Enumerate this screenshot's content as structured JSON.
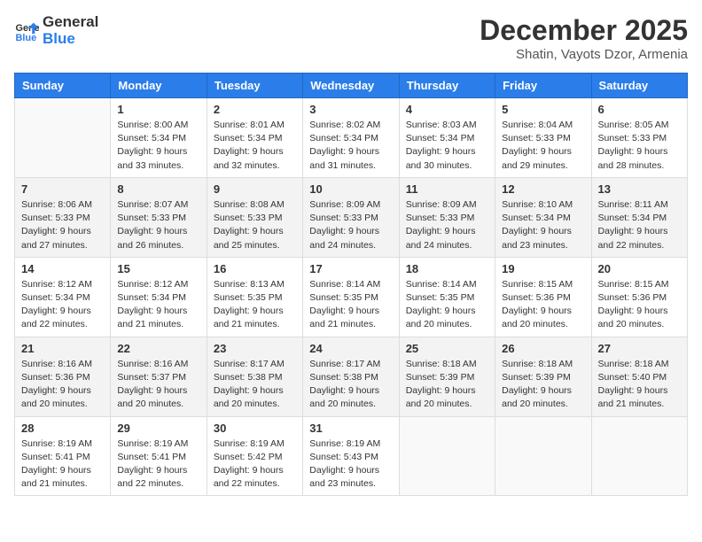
{
  "logo": {
    "general": "General",
    "blue": "Blue"
  },
  "title": "December 2025",
  "location": "Shatin, Vayots Dzor, Armenia",
  "days_of_week": [
    "Sunday",
    "Monday",
    "Tuesday",
    "Wednesday",
    "Thursday",
    "Friday",
    "Saturday"
  ],
  "weeks": [
    [
      {
        "day": "",
        "sunrise": "",
        "sunset": "",
        "daylight": ""
      },
      {
        "day": "1",
        "sunrise": "Sunrise: 8:00 AM",
        "sunset": "Sunset: 5:34 PM",
        "daylight": "Daylight: 9 hours and 33 minutes."
      },
      {
        "day": "2",
        "sunrise": "Sunrise: 8:01 AM",
        "sunset": "Sunset: 5:34 PM",
        "daylight": "Daylight: 9 hours and 32 minutes."
      },
      {
        "day": "3",
        "sunrise": "Sunrise: 8:02 AM",
        "sunset": "Sunset: 5:34 PM",
        "daylight": "Daylight: 9 hours and 31 minutes."
      },
      {
        "day": "4",
        "sunrise": "Sunrise: 8:03 AM",
        "sunset": "Sunset: 5:34 PM",
        "daylight": "Daylight: 9 hours and 30 minutes."
      },
      {
        "day": "5",
        "sunrise": "Sunrise: 8:04 AM",
        "sunset": "Sunset: 5:33 PM",
        "daylight": "Daylight: 9 hours and 29 minutes."
      },
      {
        "day": "6",
        "sunrise": "Sunrise: 8:05 AM",
        "sunset": "Sunset: 5:33 PM",
        "daylight": "Daylight: 9 hours and 28 minutes."
      }
    ],
    [
      {
        "day": "7",
        "sunrise": "Sunrise: 8:06 AM",
        "sunset": "Sunset: 5:33 PM",
        "daylight": "Daylight: 9 hours and 27 minutes."
      },
      {
        "day": "8",
        "sunrise": "Sunrise: 8:07 AM",
        "sunset": "Sunset: 5:33 PM",
        "daylight": "Daylight: 9 hours and 26 minutes."
      },
      {
        "day": "9",
        "sunrise": "Sunrise: 8:08 AM",
        "sunset": "Sunset: 5:33 PM",
        "daylight": "Daylight: 9 hours and 25 minutes."
      },
      {
        "day": "10",
        "sunrise": "Sunrise: 8:09 AM",
        "sunset": "Sunset: 5:33 PM",
        "daylight": "Daylight: 9 hours and 24 minutes."
      },
      {
        "day": "11",
        "sunrise": "Sunrise: 8:09 AM",
        "sunset": "Sunset: 5:33 PM",
        "daylight": "Daylight: 9 hours and 24 minutes."
      },
      {
        "day": "12",
        "sunrise": "Sunrise: 8:10 AM",
        "sunset": "Sunset: 5:34 PM",
        "daylight": "Daylight: 9 hours and 23 minutes."
      },
      {
        "day": "13",
        "sunrise": "Sunrise: 8:11 AM",
        "sunset": "Sunset: 5:34 PM",
        "daylight": "Daylight: 9 hours and 22 minutes."
      }
    ],
    [
      {
        "day": "14",
        "sunrise": "Sunrise: 8:12 AM",
        "sunset": "Sunset: 5:34 PM",
        "daylight": "Daylight: 9 hours and 22 minutes."
      },
      {
        "day": "15",
        "sunrise": "Sunrise: 8:12 AM",
        "sunset": "Sunset: 5:34 PM",
        "daylight": "Daylight: 9 hours and 21 minutes."
      },
      {
        "day": "16",
        "sunrise": "Sunrise: 8:13 AM",
        "sunset": "Sunset: 5:35 PM",
        "daylight": "Daylight: 9 hours and 21 minutes."
      },
      {
        "day": "17",
        "sunrise": "Sunrise: 8:14 AM",
        "sunset": "Sunset: 5:35 PM",
        "daylight": "Daylight: 9 hours and 21 minutes."
      },
      {
        "day": "18",
        "sunrise": "Sunrise: 8:14 AM",
        "sunset": "Sunset: 5:35 PM",
        "daylight": "Daylight: 9 hours and 20 minutes."
      },
      {
        "day": "19",
        "sunrise": "Sunrise: 8:15 AM",
        "sunset": "Sunset: 5:36 PM",
        "daylight": "Daylight: 9 hours and 20 minutes."
      },
      {
        "day": "20",
        "sunrise": "Sunrise: 8:15 AM",
        "sunset": "Sunset: 5:36 PM",
        "daylight": "Daylight: 9 hours and 20 minutes."
      }
    ],
    [
      {
        "day": "21",
        "sunrise": "Sunrise: 8:16 AM",
        "sunset": "Sunset: 5:36 PM",
        "daylight": "Daylight: 9 hours and 20 minutes."
      },
      {
        "day": "22",
        "sunrise": "Sunrise: 8:16 AM",
        "sunset": "Sunset: 5:37 PM",
        "daylight": "Daylight: 9 hours and 20 minutes."
      },
      {
        "day": "23",
        "sunrise": "Sunrise: 8:17 AM",
        "sunset": "Sunset: 5:38 PM",
        "daylight": "Daylight: 9 hours and 20 minutes."
      },
      {
        "day": "24",
        "sunrise": "Sunrise: 8:17 AM",
        "sunset": "Sunset: 5:38 PM",
        "daylight": "Daylight: 9 hours and 20 minutes."
      },
      {
        "day": "25",
        "sunrise": "Sunrise: 8:18 AM",
        "sunset": "Sunset: 5:39 PM",
        "daylight": "Daylight: 9 hours and 20 minutes."
      },
      {
        "day": "26",
        "sunrise": "Sunrise: 8:18 AM",
        "sunset": "Sunset: 5:39 PM",
        "daylight": "Daylight: 9 hours and 20 minutes."
      },
      {
        "day": "27",
        "sunrise": "Sunrise: 8:18 AM",
        "sunset": "Sunset: 5:40 PM",
        "daylight": "Daylight: 9 hours and 21 minutes."
      }
    ],
    [
      {
        "day": "28",
        "sunrise": "Sunrise: 8:19 AM",
        "sunset": "Sunset: 5:41 PM",
        "daylight": "Daylight: 9 hours and 21 minutes."
      },
      {
        "day": "29",
        "sunrise": "Sunrise: 8:19 AM",
        "sunset": "Sunset: 5:41 PM",
        "daylight": "Daylight: 9 hours and 22 minutes."
      },
      {
        "day": "30",
        "sunrise": "Sunrise: 8:19 AM",
        "sunset": "Sunset: 5:42 PM",
        "daylight": "Daylight: 9 hours and 22 minutes."
      },
      {
        "day": "31",
        "sunrise": "Sunrise: 8:19 AM",
        "sunset": "Sunset: 5:43 PM",
        "daylight": "Daylight: 9 hours and 23 minutes."
      },
      {
        "day": "",
        "sunrise": "",
        "sunset": "",
        "daylight": ""
      },
      {
        "day": "",
        "sunrise": "",
        "sunset": "",
        "daylight": ""
      },
      {
        "day": "",
        "sunrise": "",
        "sunset": "",
        "daylight": ""
      }
    ]
  ]
}
